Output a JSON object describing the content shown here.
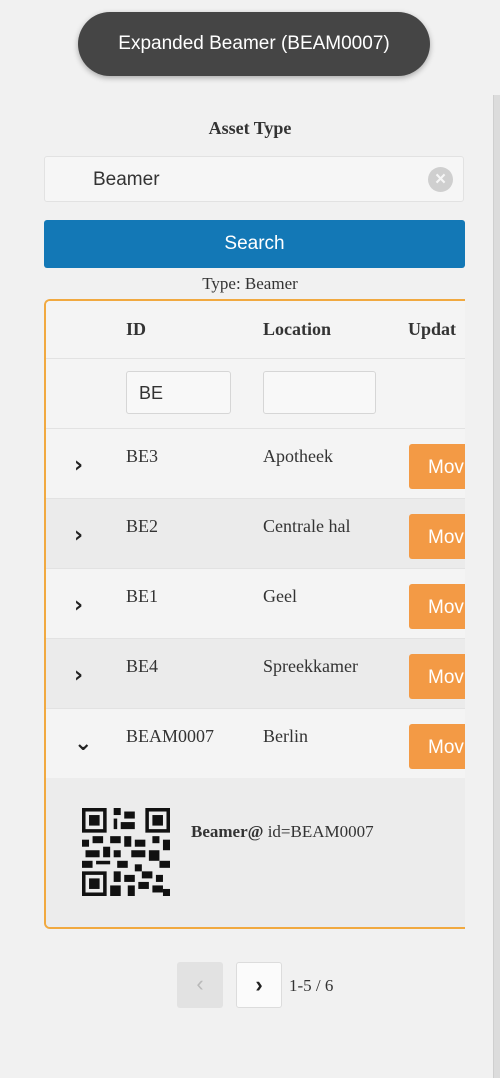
{
  "toast": {
    "text": "Expanded Beamer (BEAM0007)"
  },
  "filter": {
    "asset_type_label": "Asset Type",
    "asset_type_value": "Beamer",
    "clear_icon": "circle-x-icon",
    "search_label": "Search"
  },
  "type_label": "Type: Beamer",
  "table": {
    "headers": {
      "id": "ID",
      "location": "Location",
      "update": "Updat"
    },
    "filters": {
      "id": "BE",
      "location": ""
    },
    "rows": [
      {
        "expanded": false,
        "id": "BE3",
        "location": "Apotheek",
        "action": "Mov"
      },
      {
        "expanded": false,
        "id": "BE2",
        "location": "Centrale hal",
        "action": "Mov"
      },
      {
        "expanded": false,
        "id": "BE1",
        "location": "Geel",
        "action": "Mov"
      },
      {
        "expanded": false,
        "id": "BE4",
        "location": "Spreekkamer",
        "action": "Mov"
      },
      {
        "expanded": true,
        "id": "BEAM0007",
        "location": "Berlin",
        "action": "Mov"
      }
    ],
    "detail": {
      "name": "Beamer@",
      "id_text": " id=BEAM0007"
    }
  },
  "pagination": {
    "prev_icon": "chevron-left-icon",
    "next_icon": "chevron-right-icon",
    "info": "1-5 / 6"
  },
  "colors": {
    "accent": "#1378b6",
    "action": "#f39a45",
    "frame": "#f1a940",
    "toast": "#454545"
  }
}
